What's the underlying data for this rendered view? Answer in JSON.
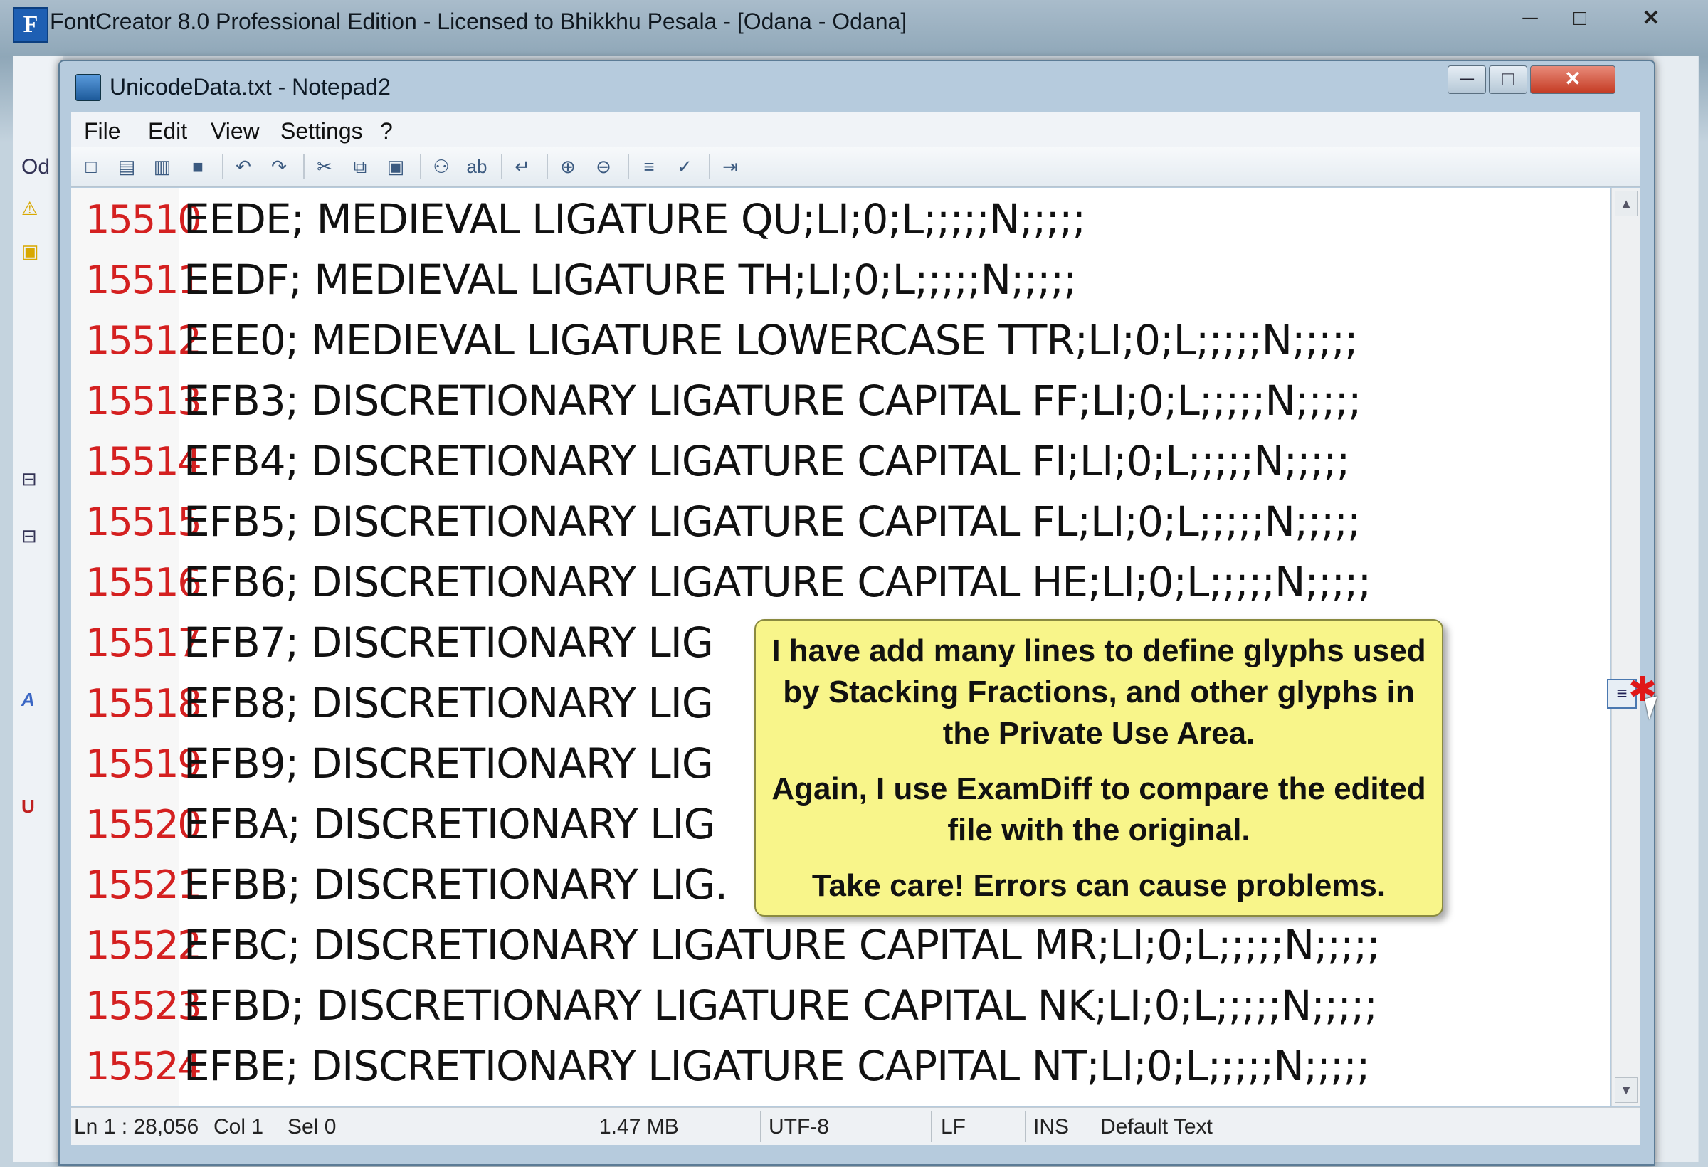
{
  "outer_window": {
    "title": "FontCreator 8.0 Professional Edition - Licensed to Bhikkhu Pesala - [Odana - Odana]",
    "logo": "F",
    "min_glyph": "─",
    "max_glyph": "□",
    "close_glyph": "✕",
    "left_tab": "Od"
  },
  "notepad": {
    "title": "UnicodeData.txt - Notepad2",
    "min_glyph": "─",
    "max_glyph": "□",
    "close_glyph": "✕",
    "menu": [
      "File",
      "Edit",
      "View",
      "Settings",
      "?"
    ],
    "toolbar_icons": [
      "new-file-icon",
      "open-file-icon",
      "browse-icon",
      "save-icon",
      "undo-icon",
      "redo-icon",
      "cut-icon",
      "copy-icon",
      "paste-icon",
      "find-icon",
      "replace-icon",
      "word-wrap-icon",
      "zoom-in-icon",
      "zoom-out-icon",
      "select-scheme-icon",
      "customize-scheme-icon",
      "exit-icon"
    ],
    "toolbar_glyphs": [
      "□",
      "▤",
      "▥",
      "■",
      "↶",
      "↷",
      "✂",
      "⧉",
      "▣",
      "⚇",
      "ab",
      "↵",
      "⊕",
      "⊖",
      "≡",
      "✓",
      "⇥"
    ],
    "lines": [
      {
        "num": "15510",
        "text": "EEDE; MEDIEVAL LIGATURE  QU;LI;0;L;;;;;N;;;;;"
      },
      {
        "num": "15511",
        "text": "EEDF; MEDIEVAL LIGATURE TH;LI;0;L;;;;;N;;;;;"
      },
      {
        "num": "15512",
        "text": "EEE0; MEDIEVAL LIGATURE LOWERCASE TTR;LI;0;L;;;;;N;;;;;"
      },
      {
        "num": "15513",
        "text": "EFB3;  DISCRETIONARY LIGATURE CAPITAL FF;LI;0;L;;;;;N;;;;;"
      },
      {
        "num": "15514",
        "text": "EFB4;  DISCRETIONARY LIGATURE CAPITAL FI;LI;0;L;;;;;N;;;;;"
      },
      {
        "num": "15515",
        "text": "EFB5;  DISCRETIONARY LIGATURE CAPITAL FL;LI;0;L;;;;;N;;;;;"
      },
      {
        "num": "15516",
        "text": "EFB6;  DISCRETIONARY LIGATURE CAPITAL HE;LI;0;L;;;;;N;;;;;"
      },
      {
        "num": "15517",
        "text": "EFB7;  DISCRETIONARY LIG"
      },
      {
        "num": "15518",
        "text": "EFB8;  DISCRETIONARY LIG"
      },
      {
        "num": "15519",
        "text": "EFB9;  DISCRETIONARY LIG"
      },
      {
        "num": "15520",
        "text": "EFBA;  DISCRETIONARY LIG"
      },
      {
        "num": "15521",
        "text": "EFBB;  DISCRETIONARY LIG."
      },
      {
        "num": "15522",
        "text": "EFBC;  DISCRETIONARY LIGATURE CAPITAL MR;LI;0;L;;;;;N;;;;;"
      },
      {
        "num": "15523",
        "text": "EFBD;  DISCRETIONARY LIGATURE CAPITAL NK;LI;0;L;;;;;N;;;;;"
      },
      {
        "num": "15524",
        "text": "EFBE;  DISCRETIONARY LIGATURE CAPITAL NT;LI;0;L;;;;;N;;;;;"
      }
    ],
    "status": {
      "position": "Ln 1 : 28,056",
      "col": "Col 1",
      "sel": "Sel 0",
      "size": "1.47 MB",
      "encoding": "UTF-8",
      "eol": "LF",
      "mode": "INS",
      "scheme": "Default Text"
    }
  },
  "callout": {
    "paragraphs": [
      "I have add many lines to define glyphs used by Stacking Fractions, and other glyphs in the Private Use Area.",
      "Again, I use ExamDiff to compare the edited file with the original.",
      "Take care! Errors can cause problems."
    ],
    "background": "#f8f58a"
  },
  "colors": {
    "line_number": "#d42020",
    "text": "#111111"
  }
}
